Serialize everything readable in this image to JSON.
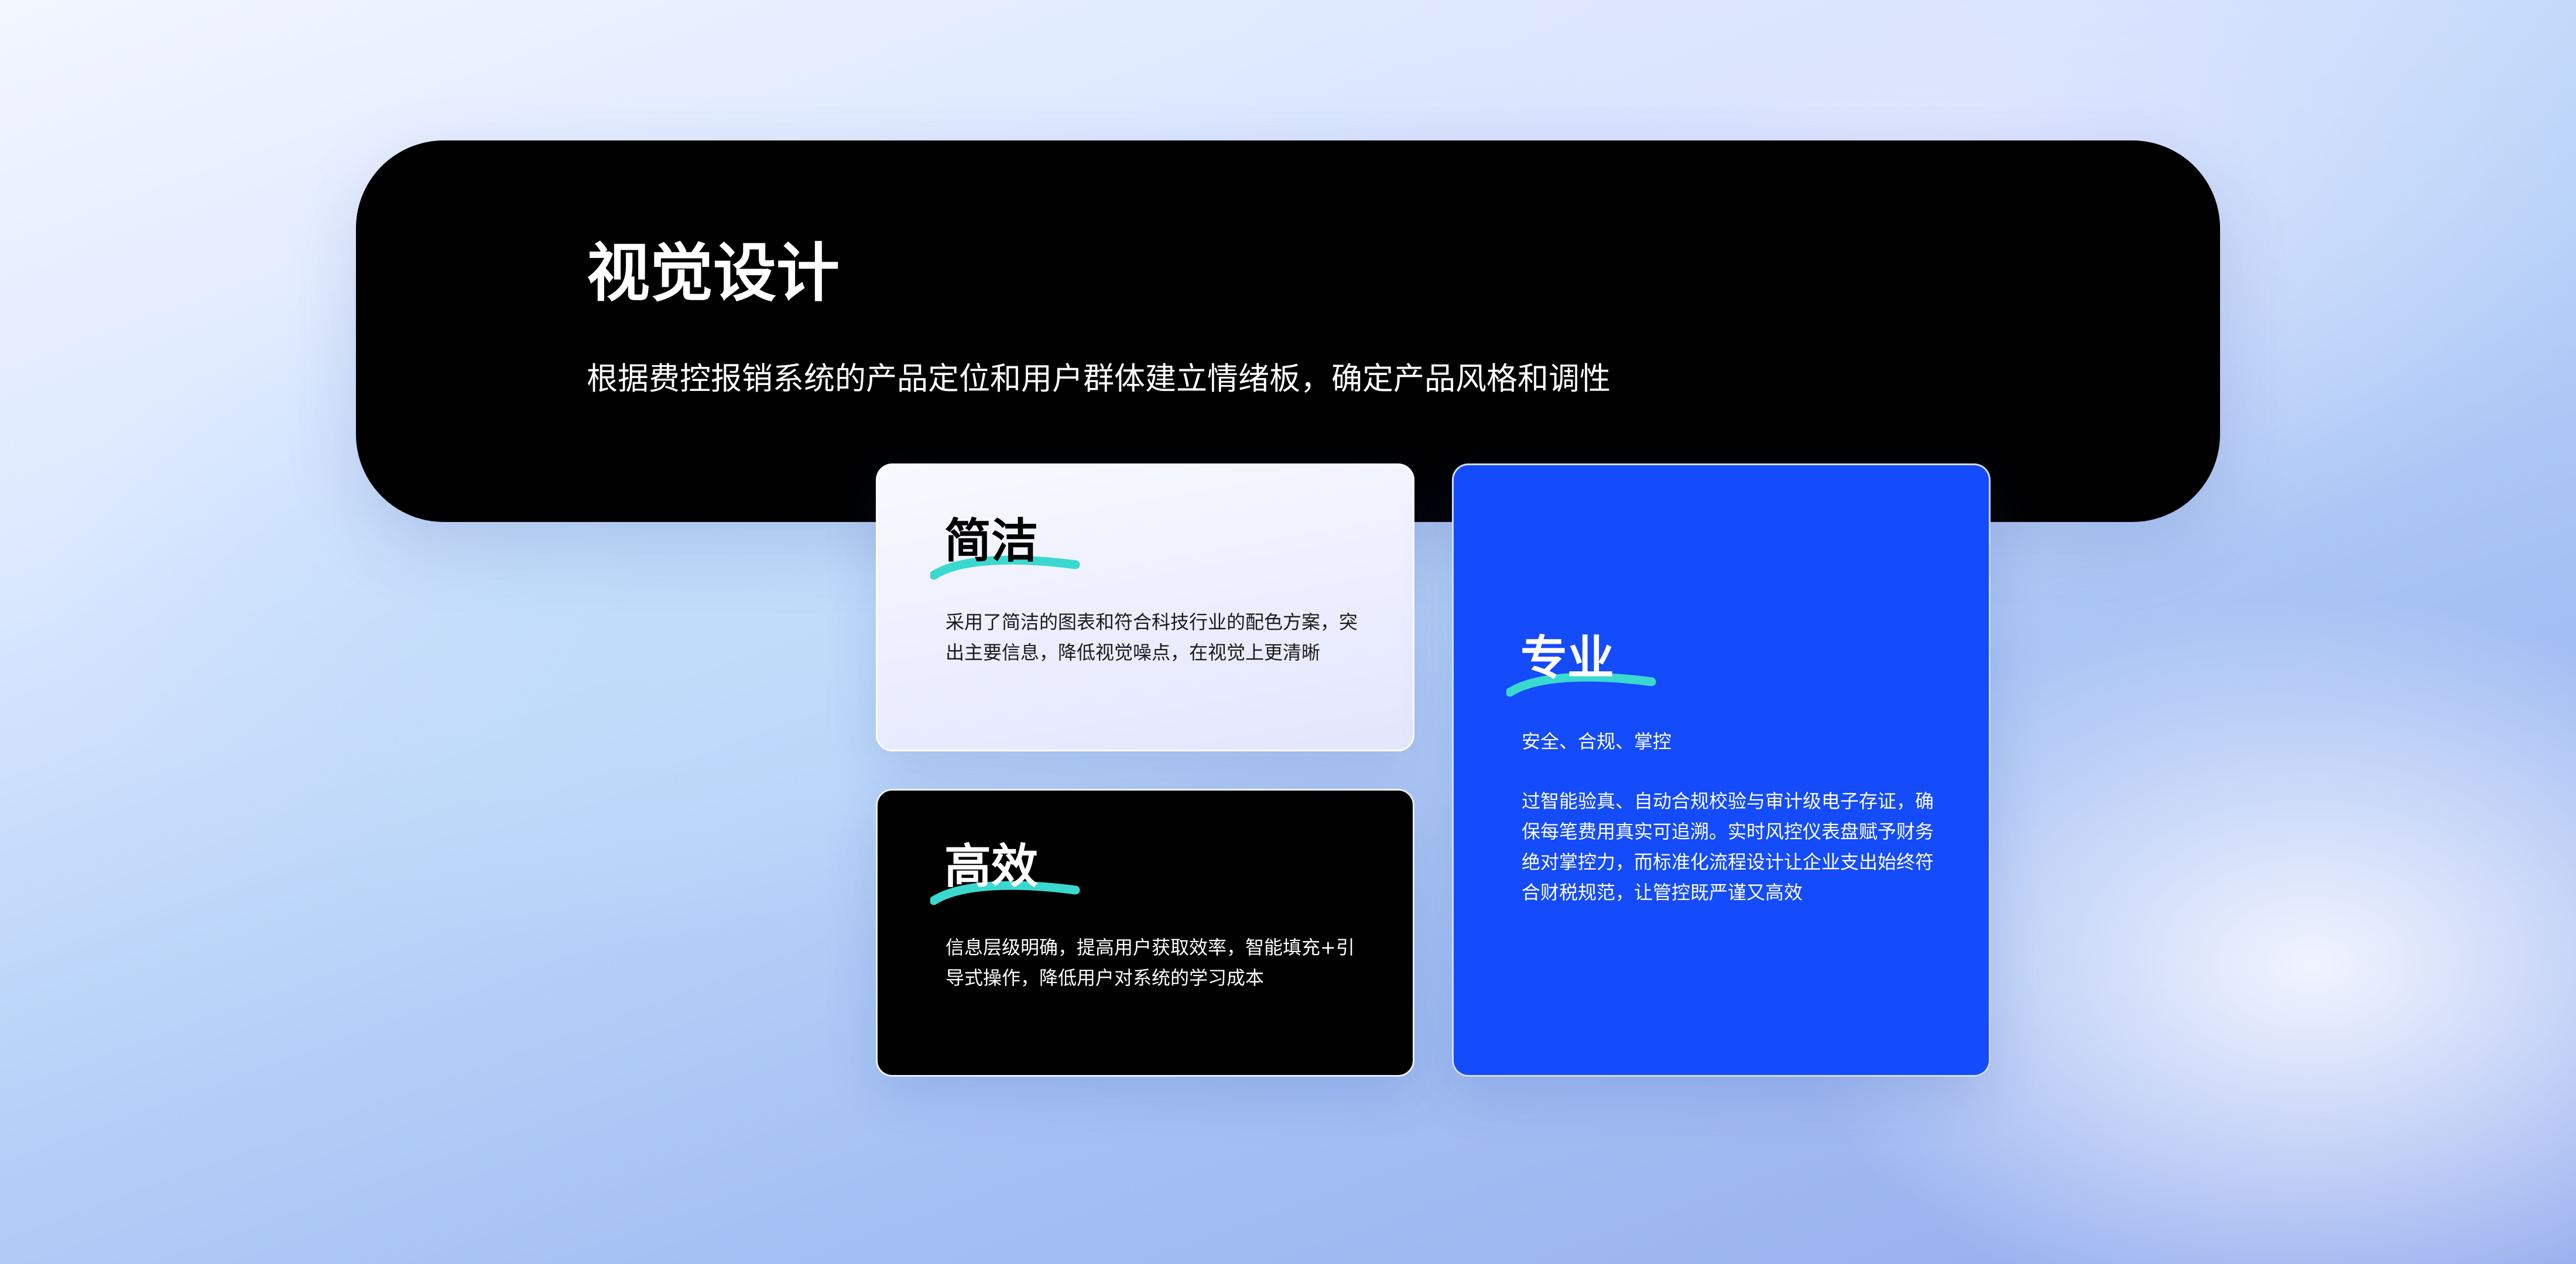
{
  "header": {
    "title": "视觉设计",
    "subtitle": "根据费控报销系统的产品定位和用户群体建立情绪板，确定产品风格和调性"
  },
  "cards": {
    "simple": {
      "title": "简洁",
      "text": "采用了简洁的图表和符合科技行业的配色方案，突出主要信息，降低视觉噪点，在视觉上更清晰"
    },
    "efficient": {
      "title": "高效",
      "text": "信息层级明确，提高用户获取效率，智能填充+引导式操作，降低用户对系统的学习成本"
    },
    "professional": {
      "title": "专业",
      "tagline": "安全、合规、掌控",
      "text": "过智能验真、自动合规校验与审计级电子存证，确保每笔费用真实可追溯。实时风控仪表盘赋予财务绝对掌控力，而标准化流程设计让企业支出始终符合财税规范，让管控既严谨又高效"
    }
  },
  "colors": {
    "panel": "#000000",
    "accent_blue": "#144bfa",
    "brush_teal": "#3ad9cf"
  },
  "icons": {
    "title_underline": "brush-stroke-icon"
  }
}
